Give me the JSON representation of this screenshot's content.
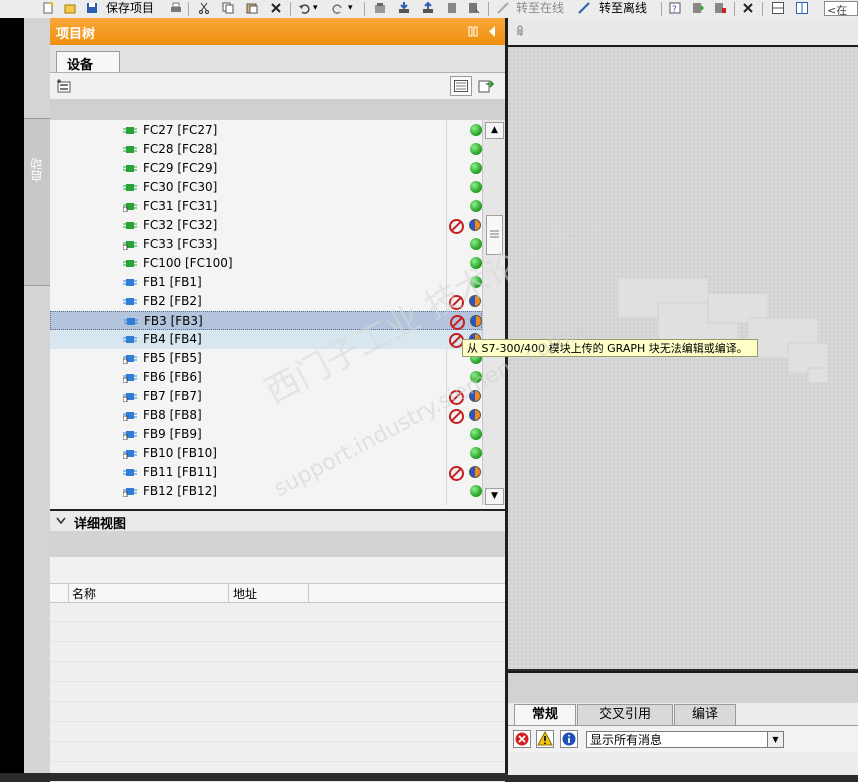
{
  "toolbar": {
    "save_project": "保存项目",
    "go_online": "转至在线",
    "go_offline": "转至离线",
    "search_placeholder": "<在项"
  },
  "sidebar": {
    "vertical_tab": "启动"
  },
  "project_tree": {
    "title": "项目树",
    "tab_devices": "设备",
    "items": [
      {
        "label": "FC27 [FC27]",
        "kind": "fc",
        "status": "ok"
      },
      {
        "label": "FC28 [FC28]",
        "kind": "fc",
        "status": "ok"
      },
      {
        "label": "FC29 [FC29]",
        "kind": "fc",
        "status": "ok"
      },
      {
        "label": "FC30 [FC30]",
        "kind": "fc",
        "status": "ok"
      },
      {
        "label": "FC31 [FC31]",
        "kind": "fc-lock",
        "status": "ok"
      },
      {
        "label": "FC32 [FC32]",
        "kind": "fc",
        "status": "diff-blocked"
      },
      {
        "label": "FC33 [FC33]",
        "kind": "fc-lock",
        "status": "ok"
      },
      {
        "label": "FC100 [FC100]",
        "kind": "fc",
        "status": "ok"
      },
      {
        "label": "FB1 [FB1]",
        "kind": "fb",
        "status": "ok"
      },
      {
        "label": "FB2 [FB2]",
        "kind": "fb",
        "status": "diff-blocked"
      },
      {
        "label": "FB3 [FB3]",
        "kind": "fb",
        "status": "diff-blocked",
        "selected": true
      },
      {
        "label": "FB4 [FB4]",
        "kind": "fb",
        "status": "diff-blocked",
        "hover": true
      },
      {
        "label": "FB5 [FB5]",
        "kind": "fb-lock",
        "status": "ok"
      },
      {
        "label": "FB6 [FB6]",
        "kind": "fb-lock",
        "status": "ok"
      },
      {
        "label": "FB7 [FB7]",
        "kind": "fb-lock",
        "status": "diff-blocked"
      },
      {
        "label": "FB8 [FB8]",
        "kind": "fb-lock",
        "status": "diff-blocked"
      },
      {
        "label": "FB9 [FB9]",
        "kind": "fb-lock",
        "status": "ok"
      },
      {
        "label": "FB10 [FB10]",
        "kind": "fb-lock",
        "status": "ok"
      },
      {
        "label": "FB11 [FB11]",
        "kind": "fb",
        "status": "diff-blocked"
      },
      {
        "label": "FB12 [FB12]",
        "kind": "fb-lock",
        "status": "ok"
      }
    ],
    "tooltip": "从 S7-300/400 模块上传的 GRAPH 块无法编辑或编译。"
  },
  "detail_view": {
    "title": "详细视图",
    "col_name": "名称",
    "col_address": "地址"
  },
  "inspector": {
    "tab_general": "常规",
    "tab_xref": "交叉引用",
    "tab_compile": "编译",
    "filter_value": "显示所有消息"
  },
  "watermark": {
    "line1": "西门子工业 技术论坛答案",
    "line2": "support.industry.siemens.com/cs"
  },
  "colors": {
    "header_orange": "#f39c12",
    "selected_row": "#b4c4dc",
    "hover_row": "#d8e6ef"
  }
}
